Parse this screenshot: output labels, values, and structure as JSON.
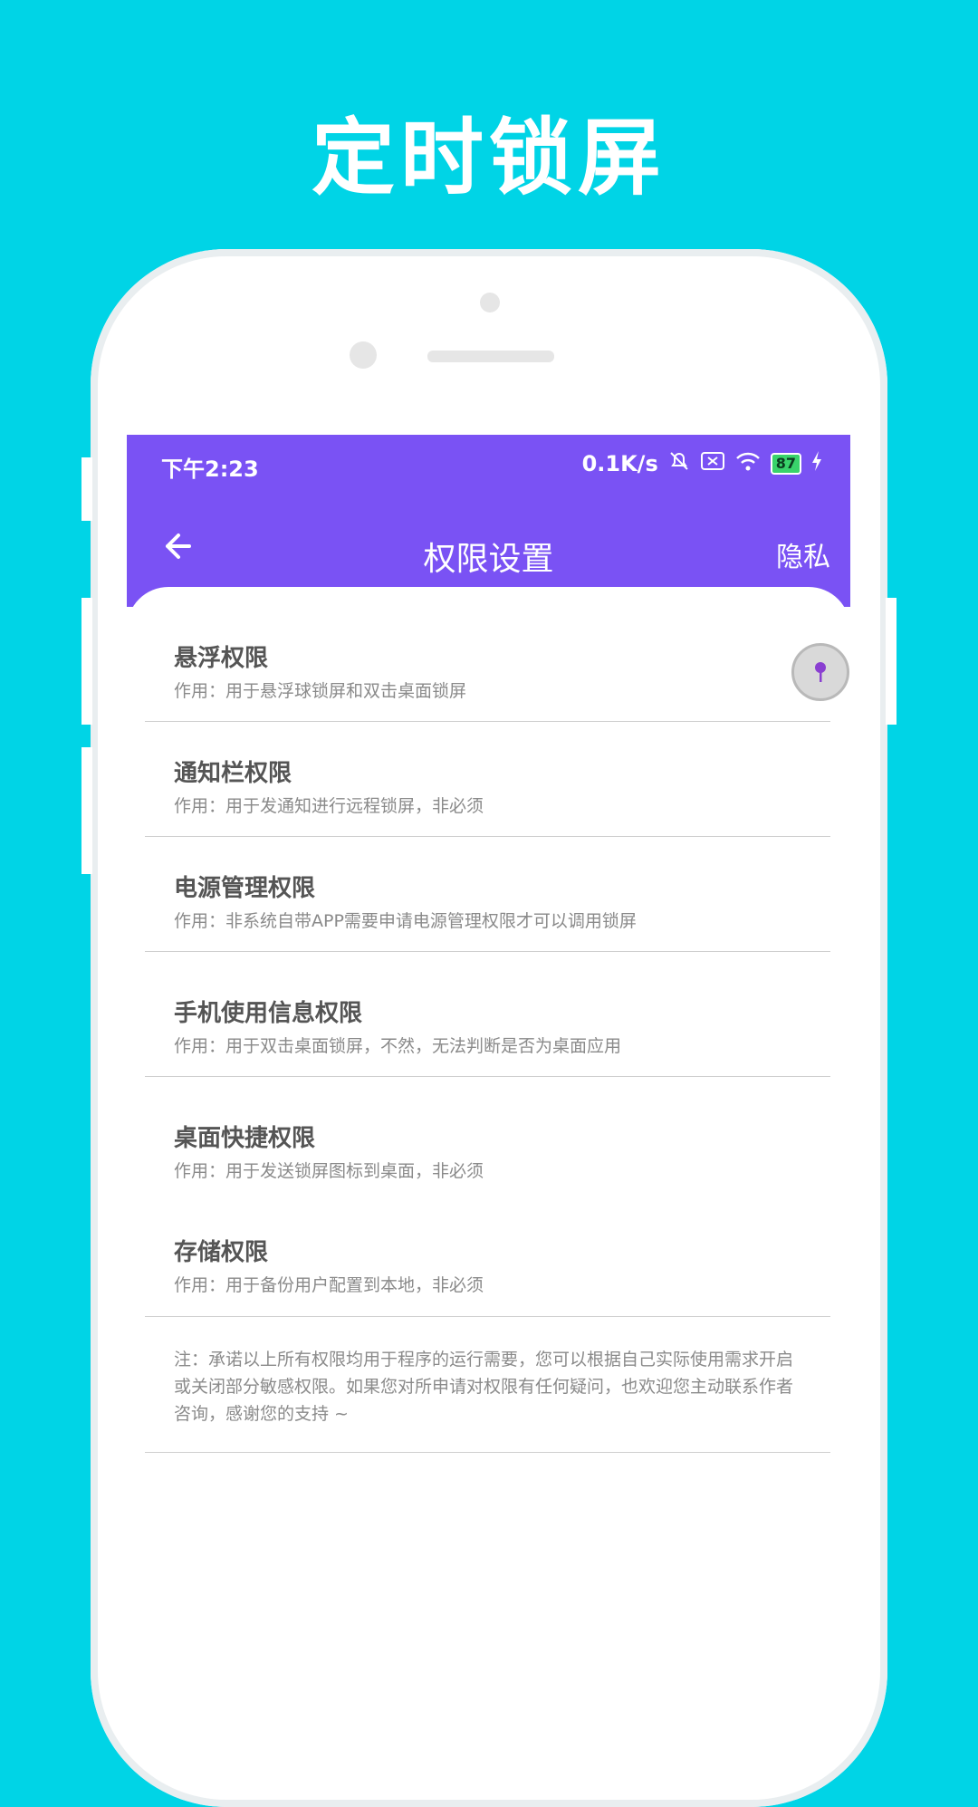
{
  "promo": {
    "title": "定时锁屏"
  },
  "status_bar": {
    "time": "下午2:23",
    "network_speed": "0.1K/s",
    "battery": "87"
  },
  "toolbar": {
    "title": "权限设置",
    "privacy": "隐私",
    "back_icon": "arrow-left-icon"
  },
  "permissions": [
    {
      "title": "悬浮权限",
      "desc": "作用：用于悬浮球锁屏和双击桌面锁屏",
      "toggle": true
    },
    {
      "title": "通知栏权限",
      "desc": "作用：用于发通知进行远程锁屏，非必须"
    },
    {
      "title": "电源管理权限",
      "desc": "作用：非系统自带APP需要申请电源管理权限才可以调用锁屏"
    },
    {
      "title": "手机使用信息权限",
      "desc": "作用：用于双击桌面锁屏，不然，无法判断是否为桌面应用"
    },
    {
      "title": "桌面快捷权限",
      "desc": "作用：用于发送锁屏图标到桌面，非必须"
    },
    {
      "title": "存储权限",
      "desc": "作用：用于备份用户配置到本地，非必须"
    }
  ],
  "note": "注：承诺以上所有权限均用于程序的运行需要，您可以根据自己实际使用需求开启或关闭部分敏感权限。如果您对所申请对权限有任何疑问，也欢迎您主动联系作者咨询，感谢您的支持 ~",
  "colors": {
    "background": "#00d4e6",
    "accent": "#7a52f4",
    "toggle_dot": "#8a3fd1"
  }
}
